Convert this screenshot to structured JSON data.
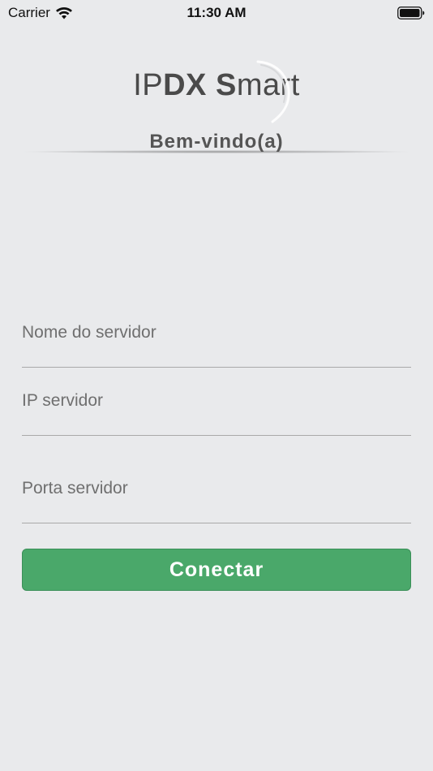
{
  "status_bar": {
    "carrier": "Carrier",
    "time": "11:30 AM"
  },
  "header": {
    "logo_light_prefix": "IP",
    "logo_bold": "DX",
    "logo_light_mid": " ",
    "logo_bold_2": "S",
    "logo_light_suffix": "mart",
    "welcome": "Bem-vindo(a)"
  },
  "form": {
    "server_name_placeholder": "Nome do servidor",
    "server_ip_placeholder": "IP servidor",
    "server_port_placeholder": "Porta servidor",
    "connect_label": "Conectar"
  },
  "colors": {
    "background": "#e9eaec",
    "button": "#4aa86a",
    "button_text": "#ffffff"
  },
  "icons": {
    "wifi": "wifi-icon",
    "battery": "battery-icon"
  }
}
